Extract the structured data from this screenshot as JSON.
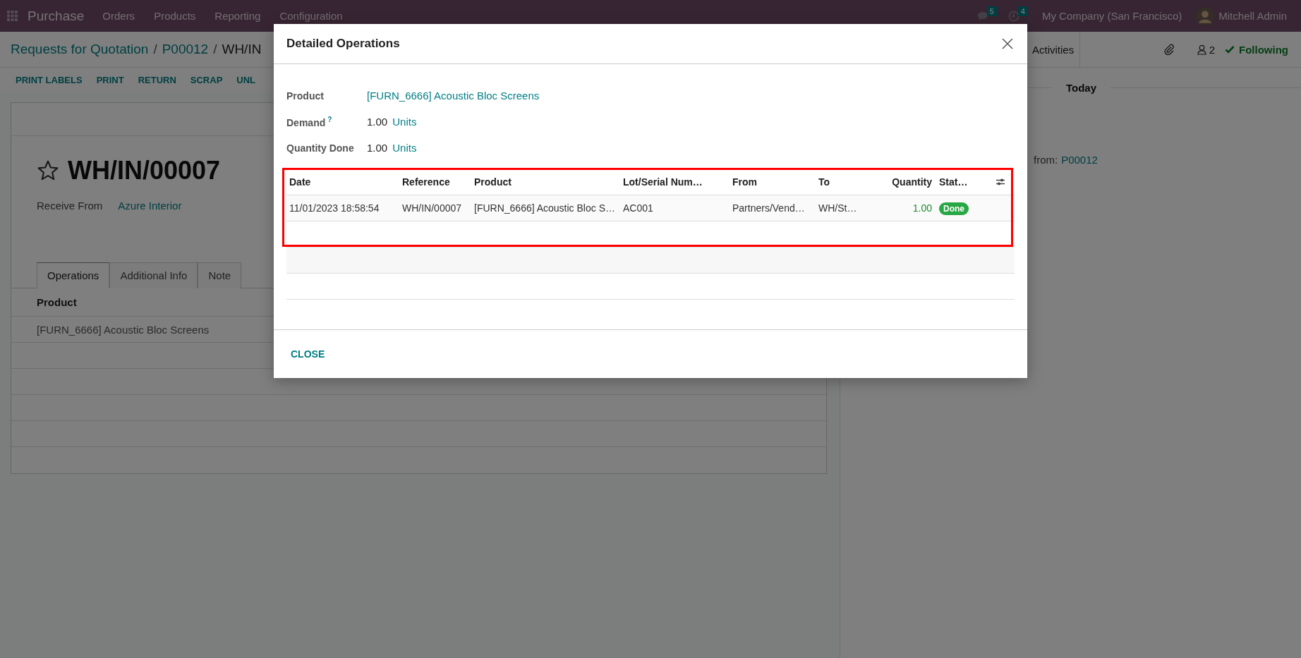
{
  "navbar": {
    "app": "Purchase",
    "menu": [
      "Orders",
      "Products",
      "Reporting",
      "Configuration"
    ],
    "messages_count": "5",
    "activities_count": "4",
    "company": "My Company (San Francisco)",
    "user": "Mitchell Admin"
  },
  "breadcrumb": [
    {
      "label": "Requests for Quotation"
    },
    {
      "separator": "/",
      "label": "P00012"
    },
    {
      "separator": "/",
      "label": "WH/IN"
    }
  ],
  "actions": [
    "PRINT LABELS",
    "PRINT",
    "RETURN",
    "SCRAP",
    "UNL"
  ],
  "record": {
    "name": "WH/IN/00007",
    "starred": false,
    "fields": [
      {
        "label": "Receive From",
        "value": "Azure Interior"
      }
    ],
    "tabs": [
      {
        "label": "Operations",
        "selected": true
      },
      {
        "label": "Additional Info",
        "selected": false
      },
      {
        "label": "Note",
        "selected": false
      }
    ],
    "lines": {
      "columns": [
        "Product"
      ],
      "rows": [
        [
          "[FURN_6666] Acoustic Bloc Screens"
        ]
      ]
    }
  },
  "chatter": {
    "activities": "Activities",
    "followers": "2",
    "following": "Following",
    "date_separator": "Today",
    "message": {
      "text": "from:",
      "link": "P00012"
    }
  },
  "dialog": {
    "title": "Detailed Operations",
    "fields": [
      {
        "kind": "link",
        "label": "Product",
        "value": "[FURN_6666] Acoustic Bloc Screens"
      },
      {
        "kind": "quantity",
        "label": "Demand",
        "help": "?",
        "value": "1.00",
        "unit": "Units"
      },
      {
        "kind": "quantity",
        "label": "Quantity Done",
        "value": "1.00",
        "unit": "Units"
      }
    ],
    "table": {
      "highlighted": true,
      "columns": [
        "Date",
        "Reference",
        "Product",
        "Lot/Serial Num…",
        "From",
        "To",
        "Quantity",
        "Stat…"
      ],
      "rows": [
        {
          "cells": [
            "11/01/2023 18:58:54",
            "WH/IN/00007",
            "[FURN_6666] Acoustic Bloc S…",
            "AC001",
            "Partners/Vend…",
            "WH/St…",
            "1.00"
          ],
          "status": "Done"
        }
      ]
    },
    "buttons": [
      "CLOSE"
    ]
  }
}
